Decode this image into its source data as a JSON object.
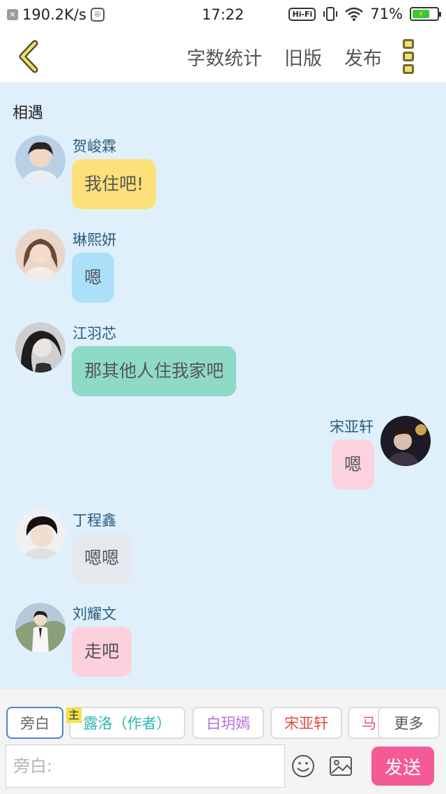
{
  "status_bar": {
    "network_speed": "190.2K/s",
    "time": "17:22",
    "hifi": "Hi-Fi",
    "battery": "71%"
  },
  "nav": {
    "back_icon": "chevron-left-icon",
    "word_count": "字数统计",
    "old_version": "旧版",
    "publish": "发布",
    "more_icon": "more-vertical-icon"
  },
  "chat": {
    "title": "相遇",
    "messages": [
      {
        "name": "贺峻霖",
        "text": "我住吧!",
        "side": "left",
        "bubble_color": "#fde07a"
      },
      {
        "name": "琳熙妍",
        "text": "嗯",
        "side": "left",
        "bubble_color": "#ace0f8"
      },
      {
        "name": "江羽芯",
        "text": "那其他人住我家吧",
        "side": "left",
        "bubble_color": "#8fdac6"
      },
      {
        "name": "宋亚轩",
        "text": "嗯",
        "side": "right",
        "bubble_color": "#fbd3de"
      },
      {
        "name": "丁程鑫",
        "text": "嗯嗯",
        "side": "left",
        "bubble_color": "#e5e8ee"
      },
      {
        "name": "刘耀文",
        "text": "走吧",
        "side": "left",
        "bubble_color": "#fcd1dd"
      }
    ]
  },
  "roles": {
    "host_badge": "主",
    "items": [
      {
        "label": "旁白",
        "color": "#666666",
        "active": true
      },
      {
        "label": "露洛（作者）",
        "color": "#2bb6b0",
        "active": false
      },
      {
        "label": "白玥嫣",
        "color": "#b571d6",
        "active": false
      },
      {
        "label": "宋亚轩",
        "color": "#e04a3c",
        "active": false
      },
      {
        "label": "马",
        "color": "#e0559a",
        "active": false
      }
    ],
    "more_label": "更多"
  },
  "input": {
    "placeholder": "旁白:",
    "emoji_icon": "smiley-icon",
    "image_icon": "image-icon",
    "send_label": "发送"
  }
}
